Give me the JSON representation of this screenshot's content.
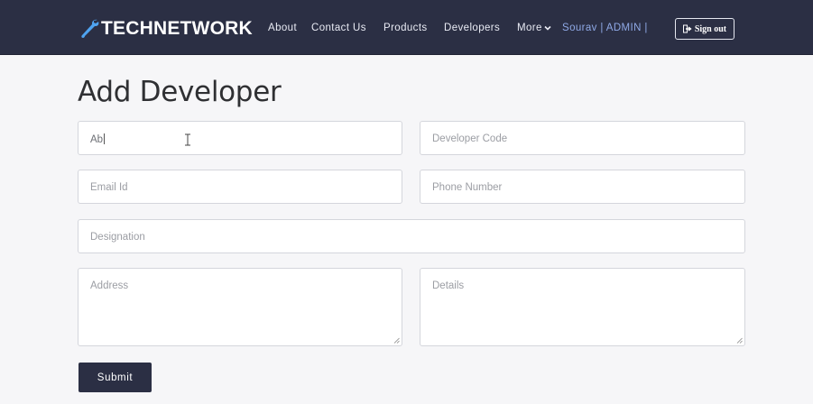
{
  "brand": {
    "name": "TECHNETWORK",
    "icon": "wrench-icon",
    "icon_color": "#4fa3f0"
  },
  "nav": {
    "about": "About",
    "contact": "Contact Us",
    "products": "Products",
    "developers": "Developers",
    "more": "More",
    "user": "Sourav | ADMIN |"
  },
  "signout": {
    "label": "Sign out",
    "icon": "sign-out-icon"
  },
  "page": {
    "title": "Add Developer"
  },
  "form": {
    "name_value": "Ab",
    "developer_code_placeholder": "Developer Code",
    "email_placeholder": "Email Id",
    "phone_placeholder": "Phone Number",
    "designation_placeholder": "Designation",
    "address_placeholder": "Address",
    "details_placeholder": "Details",
    "submit_label": "Submit"
  },
  "colors": {
    "navbar": "#2b2f44",
    "button": "#2b2f44",
    "user_link": "#8fa9e6"
  }
}
